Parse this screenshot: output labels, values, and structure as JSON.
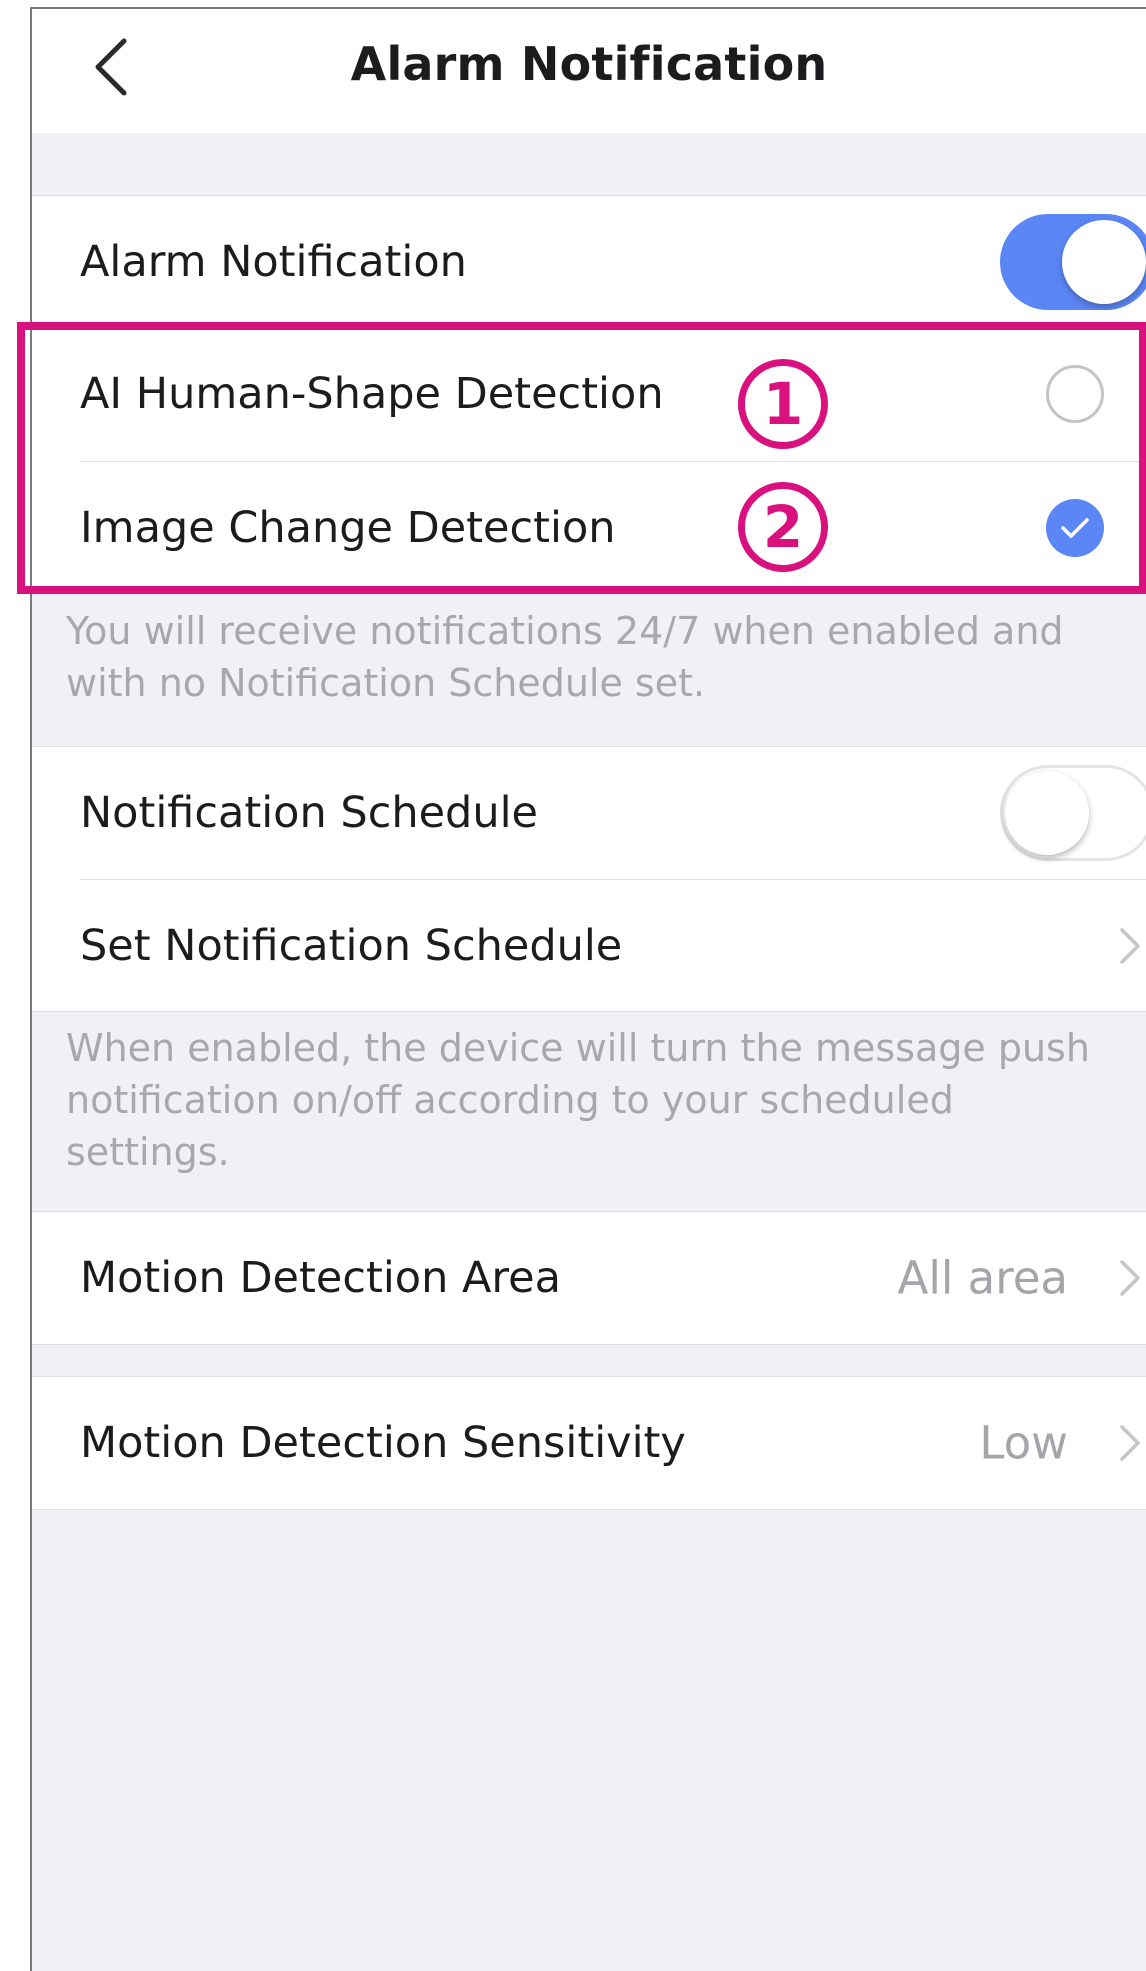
{
  "nav": {
    "title": "Alarm Notification",
    "back_icon": "chevron-left-icon"
  },
  "alarm_group": {
    "alarm_notification": {
      "label": "Alarm Notification",
      "enabled": true
    },
    "ai_human_shape": {
      "label": "AI Human-Shape Detection",
      "checked": false
    },
    "image_change": {
      "label": "Image Change Detection",
      "checked": true
    }
  },
  "alarm_footnote": "You will receive notifications 24/7 when enabled and with no Notification Schedule set.",
  "schedule_group": {
    "notification_schedule": {
      "label": "Notification Schedule",
      "enabled": false
    },
    "set_schedule": {
      "label": "Set Notification Schedule"
    }
  },
  "schedule_footnote": "When enabled, the device will turn the message push notification on/off according to your scheduled settings.",
  "motion_area": {
    "label": "Motion Detection Area",
    "value": "All area"
  },
  "motion_sensitivity": {
    "label": "Motion Detection Sensitivity",
    "value": "Low"
  },
  "annotations": {
    "badge_1": "1",
    "badge_2": "2"
  },
  "colors": {
    "accent_blue": "#5b86f5",
    "highlight_magenta": "#d9117f",
    "background": "#f0f1f6",
    "secondary_text": "#a7a8ad"
  }
}
